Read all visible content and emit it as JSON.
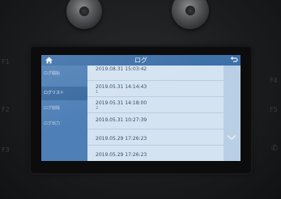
{
  "window": {
    "title": "ログ"
  },
  "topbar": {
    "home_icon": "home-icon",
    "back_icon": "back-arrow-icon"
  },
  "sidebar": {
    "items": [
      {
        "label": "ログ開始"
      },
      {
        "label": "ログリスト"
      },
      {
        "label": "ログ削除"
      },
      {
        "label": "ログ出力"
      }
    ],
    "active_index": 1
  },
  "log_list": {
    "rows": [
      {
        "timestamp": "2019.08.31 15:03:42",
        "sub": ""
      },
      {
        "timestamp": "2019.05.31 14:14:43",
        "sub": "1"
      },
      {
        "timestamp": "2019.05.31 14:18:00",
        "sub": "2"
      },
      {
        "timestamp": "2019.05.31 10:27:39",
        "sub": ""
      },
      {
        "timestamp": "2019.05.29 17:26:23",
        "sub": ""
      },
      {
        "timestamp": "2019.05.29 17:26:23",
        "sub": ""
      }
    ]
  },
  "device_labels": {
    "left": [
      "F1",
      "F2",
      "F3"
    ],
    "right": [
      "F4",
      "F5"
    ]
  },
  "colors": {
    "accent": "#3c6fa8",
    "sidebar": "#4e7fb6",
    "sidebar_active": "#3a6aa0",
    "list_bg": "#d4e3f1"
  }
}
